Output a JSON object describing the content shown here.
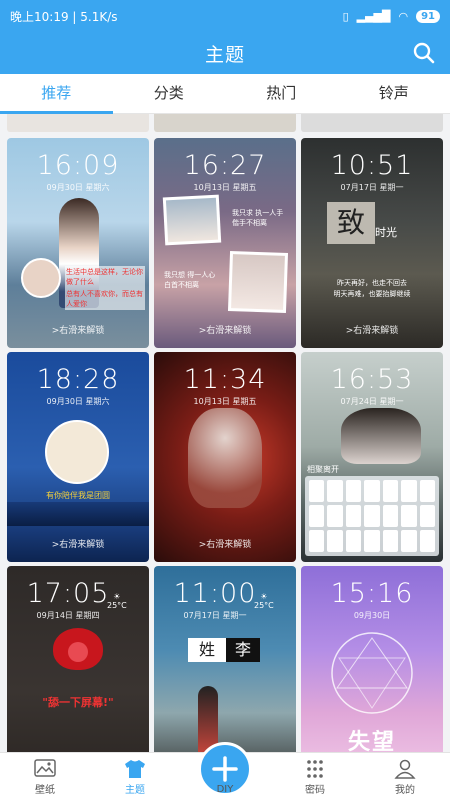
{
  "status": {
    "time": "晚上10:19 | 5.1K/s",
    "battery": "91"
  },
  "app": {
    "title": "主题"
  },
  "tabs": [
    {
      "label": "推荐",
      "active": true
    },
    {
      "label": "分类",
      "active": false
    },
    {
      "label": "热门",
      "active": false
    },
    {
      "label": "铃声",
      "active": false
    }
  ],
  "cards": [
    {
      "time": "16:09",
      "date": "09月30日 星期六",
      "text1": "生活中总是这样，无论你做了什么",
      "text2": "总有人不喜欢你，而总有人爱你",
      "unlock": ">右滑来解锁"
    },
    {
      "time": "16:27",
      "date": "10月13日 星期五",
      "text1": "我只求 执一人手 偕手不相离",
      "text2": "我只想 得一人心 白首不相离",
      "unlock": ">右滑来解锁"
    },
    {
      "time": "10:51",
      "date": "07月17日 星期一",
      "text1": "致",
      "text2": "时光",
      "text3": "昨天再好，也走不回去",
      "text4": "明天再难，也要抬脚继续",
      "unlock": ">右滑来解锁"
    },
    {
      "time": "18:28",
      "date": "09月30日 星期六",
      "text1": "有你陪伴我是团圆",
      "unlock": ">右滑来解锁"
    },
    {
      "time": "11:34",
      "date": "10月13日 星期五",
      "unlock": ">右滑来解锁"
    },
    {
      "time": "16:53",
      "date": "07月24日 星期一",
      "text1": "相聚离开",
      "unlock": ""
    },
    {
      "time": "17:05",
      "date": "09月14日 星期四",
      "temp": "25°C",
      "text1": "\"舔一下屏幕!\"",
      "unlock": ""
    },
    {
      "time": "11:00",
      "date": "07月17日 星期一",
      "temp": "25°C",
      "text1": "姓",
      "text2": "李",
      "unlock": ""
    },
    {
      "time": "15:16",
      "date": "09月30日",
      "text1": "失望",
      "unlock": ""
    }
  ],
  "nav": [
    {
      "label": "壁纸",
      "icon": "wallpaper-icon",
      "active": false
    },
    {
      "label": "主题",
      "icon": "shirt-icon",
      "active": true
    },
    {
      "label": "DIY",
      "icon": "plus-icon",
      "active": false
    },
    {
      "label": "密码",
      "icon": "keypad-icon",
      "active": false
    },
    {
      "label": "我的",
      "icon": "user-icon",
      "active": false
    }
  ],
  "colors": {
    "accent": "#3aa6f0"
  }
}
